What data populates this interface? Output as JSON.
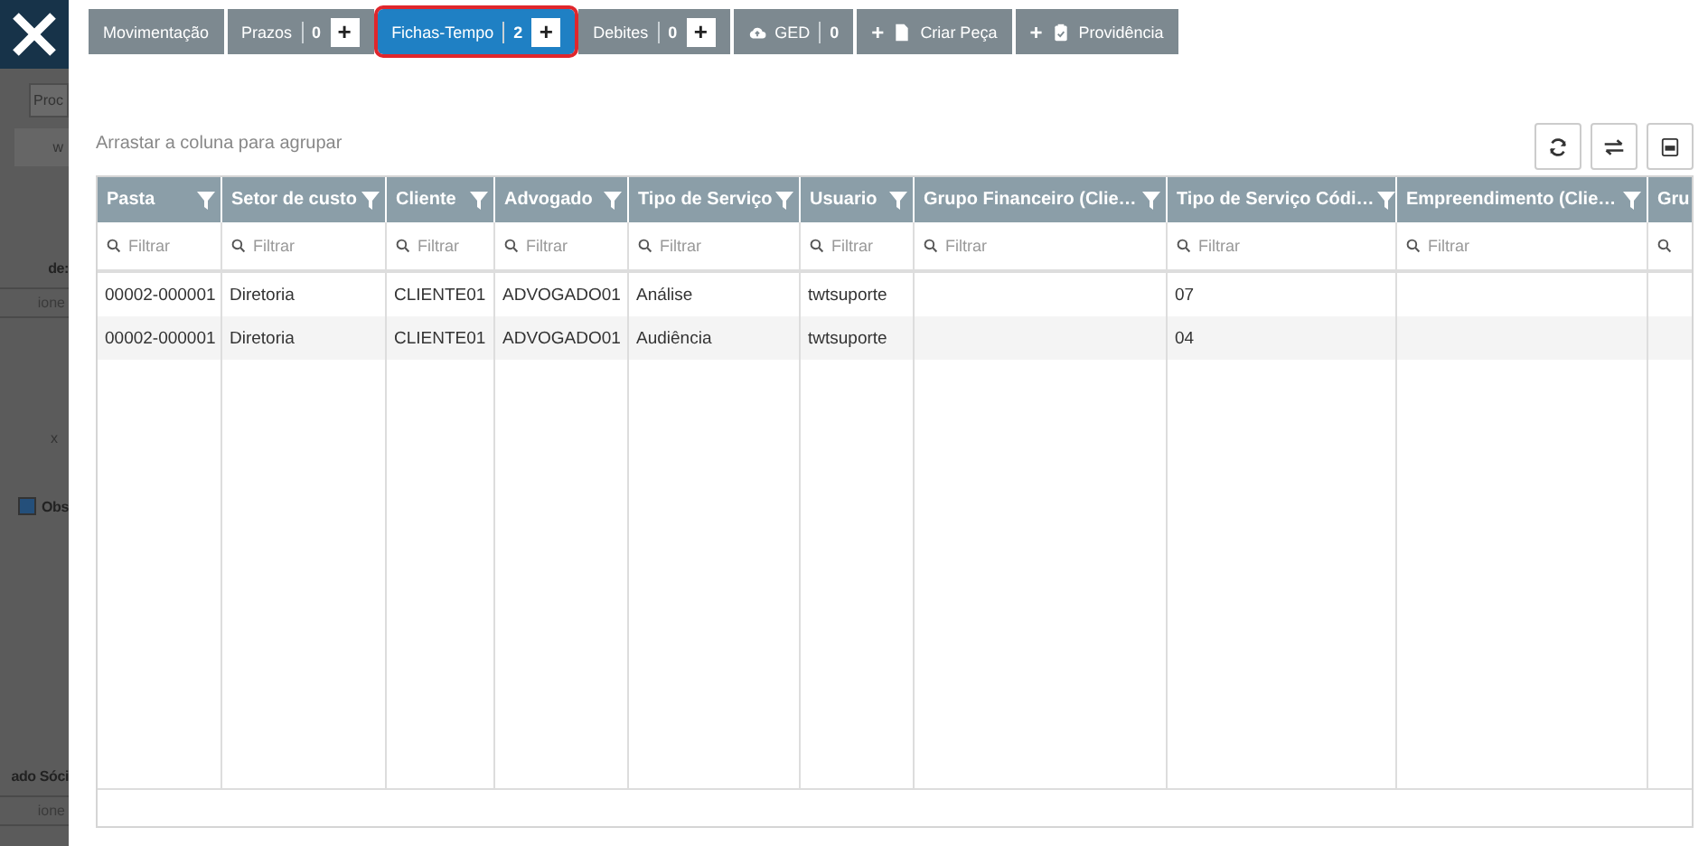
{
  "backdrop": [
    {
      "kind": "tab",
      "text": "Proc"
    },
    {
      "kind": "button",
      "text": "w"
    },
    {
      "kind": "label",
      "text": "de:"
    },
    {
      "kind": "select",
      "text": "ione"
    },
    {
      "kind": "chip",
      "text": "x"
    },
    {
      "kind": "checkbox",
      "text": "Obs",
      "checked": true
    },
    {
      "kind": "label",
      "text": "ado Sóci"
    },
    {
      "kind": "select",
      "text": "ione"
    }
  ],
  "tabs": [
    {
      "kind": "plain",
      "label": "Movimentação",
      "selected": false
    },
    {
      "kind": "counter",
      "label": "Prazos",
      "count": "0",
      "add": "+",
      "selected": false
    },
    {
      "kind": "counter",
      "label": "Fichas-Tempo",
      "count": "2",
      "add": "+",
      "selected": true
    },
    {
      "kind": "counter",
      "label": "Debites",
      "count": "0",
      "add": "+",
      "selected": false
    },
    {
      "kind": "cloud",
      "label": "GED",
      "count": "0",
      "selected": false
    },
    {
      "kind": "file",
      "label": "Criar Peça",
      "plus": "+",
      "selected": false
    },
    {
      "kind": "clipboard",
      "label": "Providência",
      "plus": "+",
      "selected": false
    }
  ],
  "group_hint": "Arrastar a coluna para agrupar",
  "toolbar": [
    {
      "kind": "refresh"
    },
    {
      "kind": "swap"
    },
    {
      "kind": "export"
    }
  ],
  "table": {
    "columns": [
      {
        "label": "Pasta",
        "placeholder": "Filtrar"
      },
      {
        "label": "Setor de custo",
        "placeholder": "Filtrar"
      },
      {
        "label": "Cliente",
        "placeholder": "Filtrar"
      },
      {
        "label": "Advogado",
        "placeholder": "Filtrar"
      },
      {
        "label": "Tipo de Serviço",
        "placeholder": "Filtrar"
      },
      {
        "label": "Usuario",
        "placeholder": "Filtrar"
      },
      {
        "label": "Grupo Financeiro (Clie…",
        "placeholder": "Filtrar"
      },
      {
        "label": "Tipo de Serviço Códi…",
        "placeholder": "Filtrar"
      },
      {
        "label": "Empreendimento (Clie…",
        "placeholder": "Filtrar"
      },
      {
        "label": "Gru"
      }
    ],
    "rows": [
      {
        "cells": [
          "00002-000001",
          "Diretoria",
          "CLIENTE01",
          "ADVOGADO01",
          "Análise",
          "twtsuporte",
          null,
          "07",
          null,
          null
        ]
      },
      {
        "cells": [
          "00002-000001",
          "Diretoria",
          "CLIENTE01",
          "ADVOGADO01",
          "Audiência",
          "twtsuporte",
          null,
          "04",
          null,
          null
        ]
      }
    ]
  }
}
